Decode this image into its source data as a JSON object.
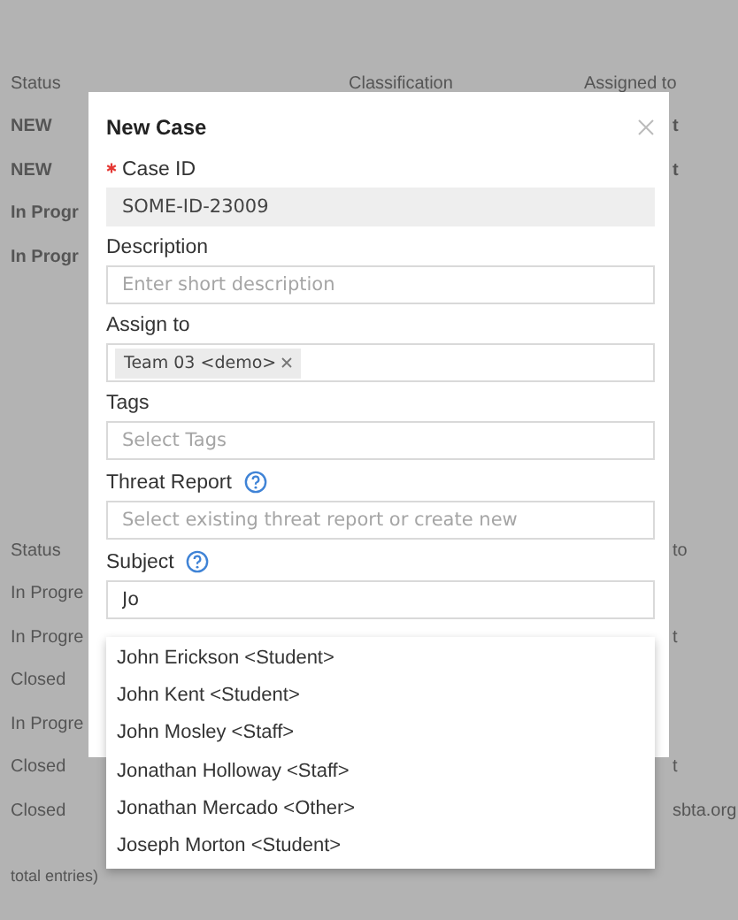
{
  "background": {
    "tables": [
      {
        "columns": [
          "Status",
          "Classification",
          "Assigned to"
        ],
        "rows": [
          {
            "status": "NEW",
            "column_3": "t",
            "bold": true
          },
          {
            "status": "NEW",
            "column_3": "t",
            "bold": true
          },
          {
            "status": "In Progr",
            "bold": true
          },
          {
            "status": "In Progr",
            "bold": true
          }
        ]
      },
      {
        "columns": [
          "Status",
          "to"
        ],
        "rows": [
          {
            "status": "In Progre",
            "bold": false
          },
          {
            "status": "In Progre",
            "column_3": "t",
            "bold": false
          },
          {
            "status": "Closed",
            "bold": false
          },
          {
            "status": "In Progre",
            "bold": false
          },
          {
            "status": "Closed",
            "column_3": "t",
            "bold": false
          },
          {
            "status": "Closed",
            "column_3": "sbta.org",
            "bold": false
          }
        ]
      }
    ],
    "footer": "total entries)"
  },
  "dialog": {
    "title": "New Case",
    "fields": [
      {
        "label": "Case ID",
        "required": true,
        "kind": "readonly",
        "value": "SOME-ID-23009"
      },
      {
        "label": "Description",
        "kind": "text",
        "placeholder": "Enter short description"
      },
      {
        "label": "Assign to",
        "kind": "tags",
        "tags": [
          "Team 03 <demo>"
        ]
      },
      {
        "label": "Tags",
        "kind": "text",
        "placeholder": "Select Tags"
      },
      {
        "label": "Threat Report",
        "help": true,
        "kind": "text",
        "placeholder": "Select existing threat report or create new"
      },
      {
        "label": "Subject",
        "help": true,
        "kind": "text",
        "value": "Jo"
      }
    ]
  },
  "suggestions": [
    "John Erickson <Student>",
    "John Kent <Student>",
    "John Mosley <Staff>",
    "Jonathan Holloway <Staff>",
    "Jonathan Mercado <Other>",
    "Joseph Morton <Student>"
  ]
}
